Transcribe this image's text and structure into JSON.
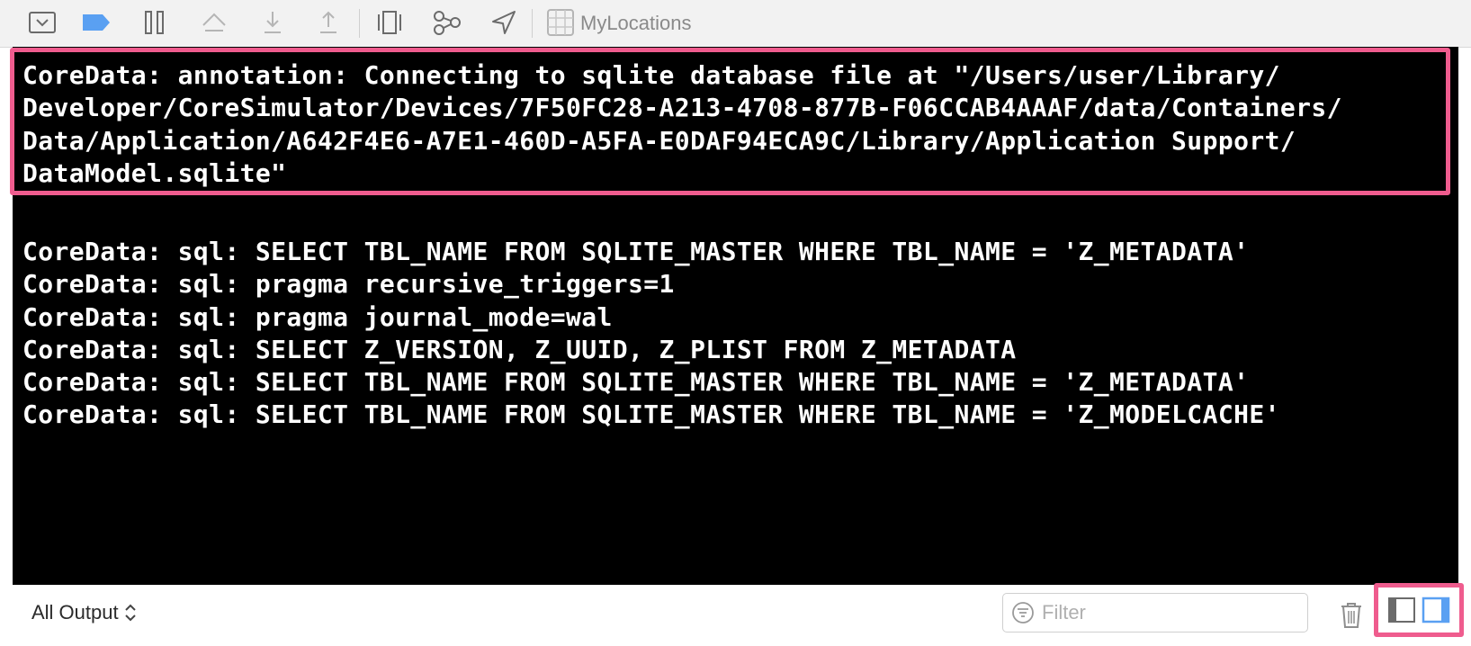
{
  "toolbar": {
    "scheme_name": "MyLocations",
    "icons": [
      "hide-debug-area-icon",
      "breakpoints-toggle-icon",
      "pause-icon",
      "step-over-icon",
      "step-into-icon",
      "step-out-icon",
      "debug-view-hierarchy-icon",
      "memory-graph-icon",
      "simulate-location-icon",
      "scheme-icon"
    ]
  },
  "console": {
    "highlighted_lines": [
      "CoreData: annotation: Connecting to sqlite database file at \"/Users/user/Library/",
      "Developer/CoreSimulator/Devices/7F50FC28-A213-4708-877B-F06CCAB4AAAF/data/Containers/",
      "Data/Application/A642F4E6-A7E1-460D-A5FA-E0DAF94ECA9C/Library/Application Support/",
      "DataModel.sqlite\""
    ],
    "partial_line": "CoreData: sql: SELECT TBL_NAME FROM SQLITE_MASTER WHERE TBL_NAME = 'Z_METADATA'",
    "lines": [
      "CoreData: sql: pragma recursive_triggers=1",
      "CoreData: sql: pragma journal_mode=wal",
      "CoreData: sql: SELECT Z_VERSION, Z_UUID, Z_PLIST FROM Z_METADATA",
      "CoreData: sql: SELECT TBL_NAME FROM SQLITE_MASTER WHERE TBL_NAME = 'Z_METADATA'",
      "CoreData: sql: SELECT TBL_NAME FROM SQLITE_MASTER WHERE TBL_NAME = 'Z_MODELCACHE'"
    ]
  },
  "bottom": {
    "output_selector": "All Output",
    "filter_placeholder": "Filter",
    "filter_value": ""
  },
  "colors": {
    "highlight": "#ef5c8e",
    "active_blue": "#5aa0f2",
    "console_bg": "#000000",
    "console_text": "#ffffff"
  }
}
